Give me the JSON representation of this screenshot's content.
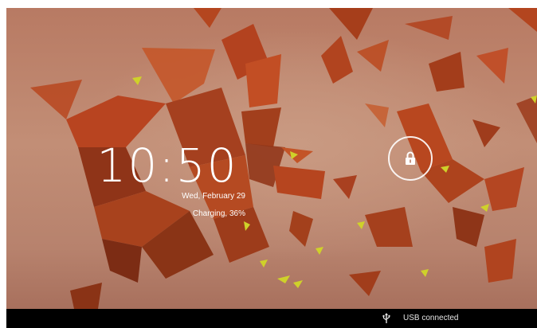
{
  "lockscreen": {
    "time": "10:50",
    "date": "Wed, February 29",
    "battery_status": "Charging, 36%",
    "unlock_icon": "lock-icon"
  },
  "status_bar": {
    "usb_icon": "usb-icon",
    "notification": "USB connected"
  },
  "colors": {
    "background": "#b87a63",
    "shard": "#b8461f",
    "accent_yellow": "#cfd12a",
    "navbar": "#000000",
    "text": "#ffffff"
  }
}
